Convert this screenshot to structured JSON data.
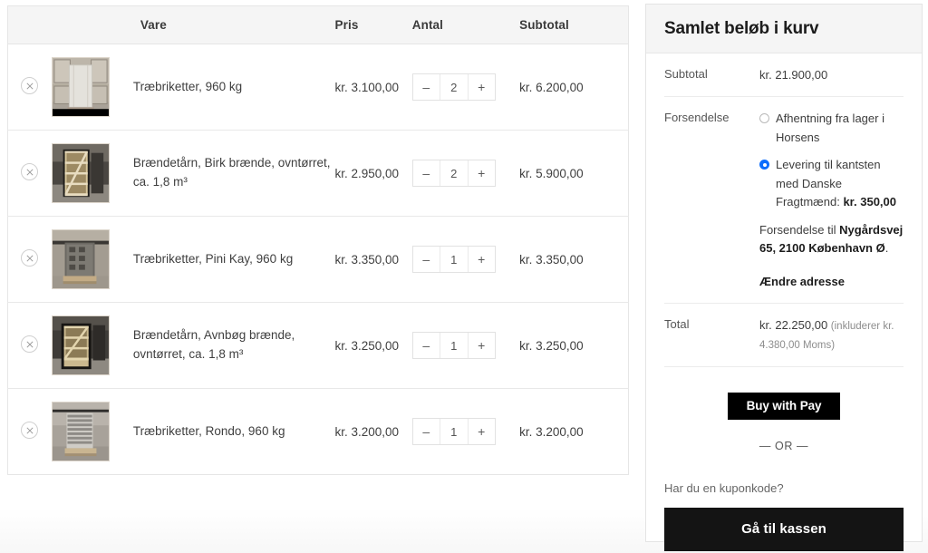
{
  "cart_table": {
    "columns": [
      "",
      "",
      "Vare",
      "Pris",
      "Antal",
      "Subtotal"
    ],
    "headers": {
      "vare": "Vare",
      "pris": "Pris",
      "antal": "Antal",
      "subtotal": "Subtotal"
    },
    "minus_label": "–",
    "plus_label": "+",
    "rows": [
      {
        "name": "Træbriketter, 960 kg",
        "price": "kr. 3.100,00",
        "qty": "2",
        "subtotal": "kr. 6.200,00",
        "thumb": "pallet-white-wrapped-briquettes"
      },
      {
        "name": "Brændetårn, Birk brænde, ovntørret, ca. 1,8 m³",
        "price": "kr. 2.950,00",
        "qty": "2",
        "subtotal": "kr. 5.900,00",
        "thumb": "firewood-tower-birch"
      },
      {
        "name": "Træbriketter, Pini Kay, 960 kg",
        "price": "kr. 3.350,00",
        "qty": "1",
        "subtotal": "kr. 3.350,00",
        "thumb": "pallet-pini-kay-briquettes"
      },
      {
        "name": "Brændetårn, Avnbøg brænde, ovntørret, ca. 1,8 m³",
        "price": "kr. 3.250,00",
        "qty": "1",
        "subtotal": "kr. 3.250,00",
        "thumb": "firewood-tower-hornbeam"
      },
      {
        "name": "Træbriketter, Rondo, 960 kg",
        "price": "kr. 3.200,00",
        "qty": "1",
        "subtotal": "kr. 3.200,00",
        "thumb": "pallet-rondo-briquettes"
      }
    ]
  },
  "totals": {
    "title": "Samlet beløb i kurv",
    "subtotal_label": "Subtotal",
    "subtotal_value": "kr. 21.900,00",
    "shipping_label": "Forsendelse",
    "shipping_options": [
      {
        "label": "Afhentning fra lager i Horsens",
        "selected": false
      },
      {
        "label": "Levering til kantsten med Danske Fragtmænd:",
        "price": "kr. 350,00",
        "selected": true
      }
    ],
    "ship_to_label": "Forsendelse til",
    "ship_to_address": "Nygårdsvej 65, 2100 København Ø",
    "ship_to_suffix": ".",
    "change_address_label": "Ændre adresse",
    "total_label": "Total",
    "total_value": "kr. 22.250,00",
    "total_tax_note": "(inkluderer kr. 4.380,00 Moms)",
    "apple_pay_prefix": "Buy with",
    "apple_pay_mark": "",
    "apple_pay_suffix": "Pay",
    "or_separator": "— OR —",
    "coupon_question": "Har du en kuponkode?",
    "checkout_label": "Gå til kassen"
  },
  "colors": {
    "accent_radio": "#0d6efd",
    "button_dark": "#141414",
    "header_bg": "#f5f5f5",
    "border": "#e6e6e6"
  }
}
